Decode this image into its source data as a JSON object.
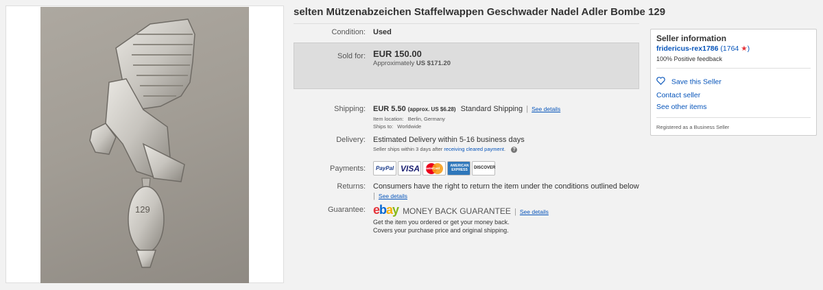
{
  "listing": {
    "title": "selten Mützenabzeichen Staffelwappen Geschwader Nadel Adler Bombe 129",
    "image_engraving": "129"
  },
  "condition": {
    "label": "Condition:",
    "value": "Used"
  },
  "sold": {
    "label": "Sold for:",
    "price": "EUR 150.00",
    "approx_prefix": "Approximately",
    "approx_value": "US $171.20"
  },
  "shipping": {
    "label": "Shipping:",
    "cost": "EUR 5.50",
    "approx": "(approx. US $6.28)",
    "method": "Standard Shipping",
    "see_details": "See details",
    "location_label": "Item location:",
    "location_value": "Berlin, Germany",
    "ships_to_label": "Ships to:",
    "ships_to_value": "Worldwide"
  },
  "delivery": {
    "label": "Delivery:",
    "estimate": "Estimated Delivery within 5-16 business days",
    "note_prefix": "Seller ships within 3 days after",
    "note_link": "receiving cleared payment",
    "note_suffix": "."
  },
  "payments": {
    "label": "Payments:",
    "methods": [
      "PayPal",
      "VISA",
      "MasterCard",
      "AMERICAN EXPRESS",
      "DISCOVER"
    ]
  },
  "returns": {
    "label": "Returns:",
    "text": "Consumers have the right to return the item under the conditions outlined below",
    "see_details": "See details"
  },
  "guarantee": {
    "label": "Guarantee:",
    "logo": "ebay",
    "title": "MONEY BACK GUARANTEE",
    "see_details": "See details",
    "line1": "Get the item you ordered or get your money back.",
    "line2": "Covers your purchase price and original shipping."
  },
  "seller": {
    "heading": "Seller information",
    "name": "fridericus-rex1786",
    "score": "1764",
    "feedback": "100% Positive feedback",
    "save": "Save this Seller",
    "contact": "Contact seller",
    "other_items": "See other items",
    "registered": "Registered as a Business Seller"
  },
  "colors": {
    "link": "#0654ba",
    "star": "#e53238",
    "sold_box": "#dddddd",
    "ebay_e": "#e53238",
    "ebay_b": "#0064d2",
    "ebay_a": "#f5af02",
    "ebay_y": "#86b817"
  },
  "icons": [
    "heart-icon",
    "star-icon",
    "question-icon"
  ]
}
